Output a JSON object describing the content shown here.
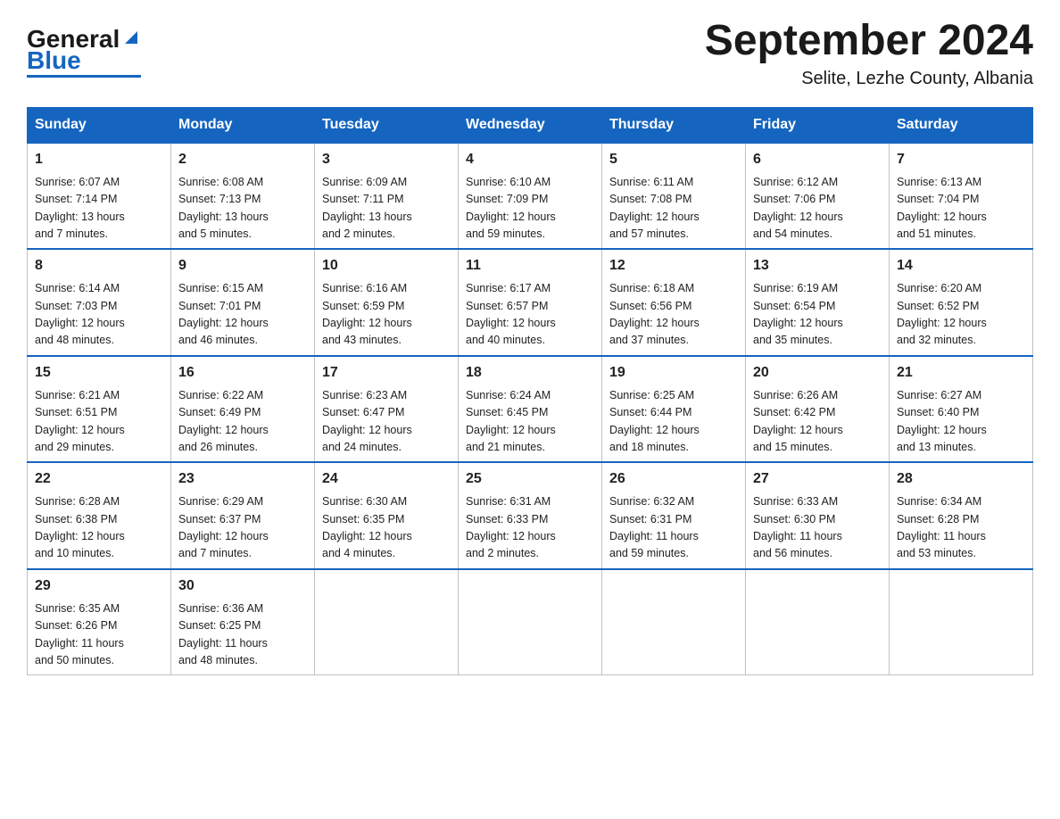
{
  "header": {
    "title": "September 2024",
    "subtitle": "Selite, Lezhe County, Albania",
    "logo_general": "General",
    "logo_blue": "Blue"
  },
  "weekdays": [
    "Sunday",
    "Monday",
    "Tuesday",
    "Wednesday",
    "Thursday",
    "Friday",
    "Saturday"
  ],
  "weeks": [
    [
      {
        "num": "1",
        "sunrise": "6:07 AM",
        "sunset": "7:14 PM",
        "daylight": "13 hours and 7 minutes."
      },
      {
        "num": "2",
        "sunrise": "6:08 AM",
        "sunset": "7:13 PM",
        "daylight": "13 hours and 5 minutes."
      },
      {
        "num": "3",
        "sunrise": "6:09 AM",
        "sunset": "7:11 PM",
        "daylight": "13 hours and 2 minutes."
      },
      {
        "num": "4",
        "sunrise": "6:10 AM",
        "sunset": "7:09 PM",
        "daylight": "12 hours and 59 minutes."
      },
      {
        "num": "5",
        "sunrise": "6:11 AM",
        "sunset": "7:08 PM",
        "daylight": "12 hours and 57 minutes."
      },
      {
        "num": "6",
        "sunrise": "6:12 AM",
        "sunset": "7:06 PM",
        "daylight": "12 hours and 54 minutes."
      },
      {
        "num": "7",
        "sunrise": "6:13 AM",
        "sunset": "7:04 PM",
        "daylight": "12 hours and 51 minutes."
      }
    ],
    [
      {
        "num": "8",
        "sunrise": "6:14 AM",
        "sunset": "7:03 PM",
        "daylight": "12 hours and 48 minutes."
      },
      {
        "num": "9",
        "sunrise": "6:15 AM",
        "sunset": "7:01 PM",
        "daylight": "12 hours and 46 minutes."
      },
      {
        "num": "10",
        "sunrise": "6:16 AM",
        "sunset": "6:59 PM",
        "daylight": "12 hours and 43 minutes."
      },
      {
        "num": "11",
        "sunrise": "6:17 AM",
        "sunset": "6:57 PM",
        "daylight": "12 hours and 40 minutes."
      },
      {
        "num": "12",
        "sunrise": "6:18 AM",
        "sunset": "6:56 PM",
        "daylight": "12 hours and 37 minutes."
      },
      {
        "num": "13",
        "sunrise": "6:19 AM",
        "sunset": "6:54 PM",
        "daylight": "12 hours and 35 minutes."
      },
      {
        "num": "14",
        "sunrise": "6:20 AM",
        "sunset": "6:52 PM",
        "daylight": "12 hours and 32 minutes."
      }
    ],
    [
      {
        "num": "15",
        "sunrise": "6:21 AM",
        "sunset": "6:51 PM",
        "daylight": "12 hours and 29 minutes."
      },
      {
        "num": "16",
        "sunrise": "6:22 AM",
        "sunset": "6:49 PM",
        "daylight": "12 hours and 26 minutes."
      },
      {
        "num": "17",
        "sunrise": "6:23 AM",
        "sunset": "6:47 PM",
        "daylight": "12 hours and 24 minutes."
      },
      {
        "num": "18",
        "sunrise": "6:24 AM",
        "sunset": "6:45 PM",
        "daylight": "12 hours and 21 minutes."
      },
      {
        "num": "19",
        "sunrise": "6:25 AM",
        "sunset": "6:44 PM",
        "daylight": "12 hours and 18 minutes."
      },
      {
        "num": "20",
        "sunrise": "6:26 AM",
        "sunset": "6:42 PM",
        "daylight": "12 hours and 15 minutes."
      },
      {
        "num": "21",
        "sunrise": "6:27 AM",
        "sunset": "6:40 PM",
        "daylight": "12 hours and 13 minutes."
      }
    ],
    [
      {
        "num": "22",
        "sunrise": "6:28 AM",
        "sunset": "6:38 PM",
        "daylight": "12 hours and 10 minutes."
      },
      {
        "num": "23",
        "sunrise": "6:29 AM",
        "sunset": "6:37 PM",
        "daylight": "12 hours and 7 minutes."
      },
      {
        "num": "24",
        "sunrise": "6:30 AM",
        "sunset": "6:35 PM",
        "daylight": "12 hours and 4 minutes."
      },
      {
        "num": "25",
        "sunrise": "6:31 AM",
        "sunset": "6:33 PM",
        "daylight": "12 hours and 2 minutes."
      },
      {
        "num": "26",
        "sunrise": "6:32 AM",
        "sunset": "6:31 PM",
        "daylight": "11 hours and 59 minutes."
      },
      {
        "num": "27",
        "sunrise": "6:33 AM",
        "sunset": "6:30 PM",
        "daylight": "11 hours and 56 minutes."
      },
      {
        "num": "28",
        "sunrise": "6:34 AM",
        "sunset": "6:28 PM",
        "daylight": "11 hours and 53 minutes."
      }
    ],
    [
      {
        "num": "29",
        "sunrise": "6:35 AM",
        "sunset": "6:26 PM",
        "daylight": "11 hours and 50 minutes."
      },
      {
        "num": "30",
        "sunrise": "6:36 AM",
        "sunset": "6:25 PM",
        "daylight": "11 hours and 48 minutes."
      },
      null,
      null,
      null,
      null,
      null
    ]
  ]
}
